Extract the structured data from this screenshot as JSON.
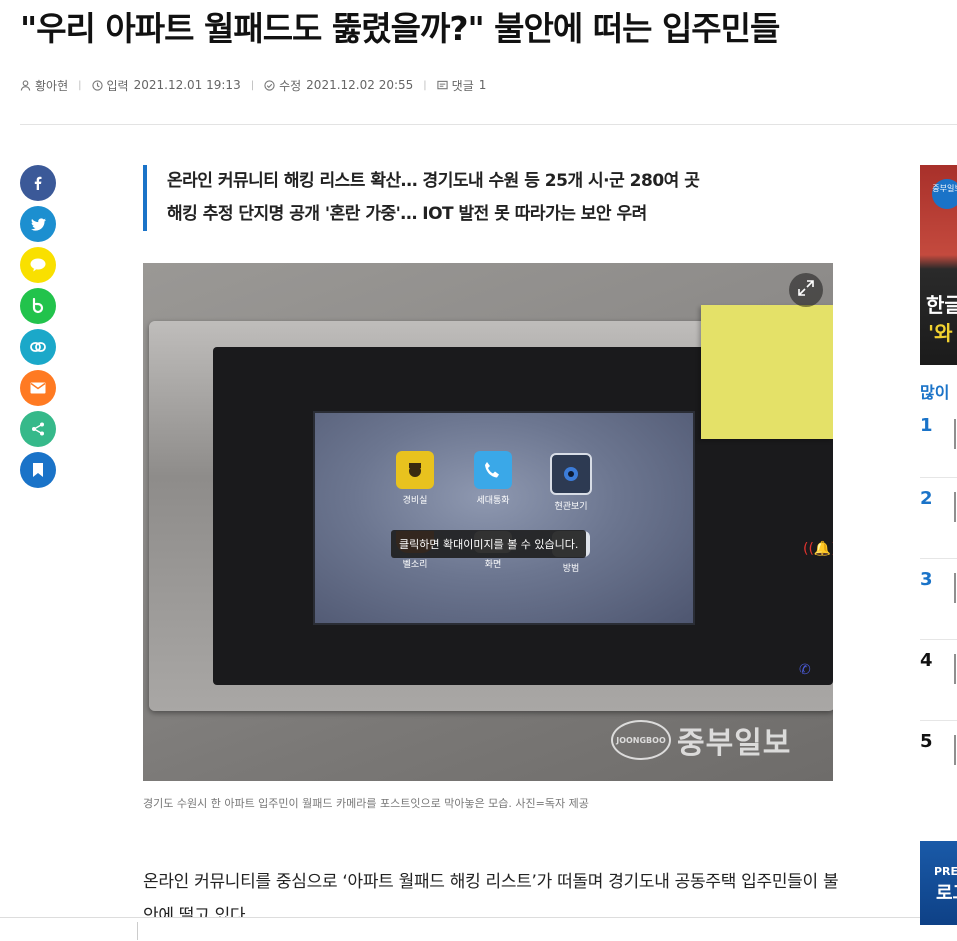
{
  "article": {
    "headline": "\"우리 아파트 월패드도 뚫렸을까?\" 불안에 떠는 입주민들",
    "author": "황아현",
    "published_label": "입력",
    "published": "2021.12.01 19:13",
    "updated_label": "수정",
    "updated": "2021.12.02 20:55",
    "comments_label": "댓글",
    "comments_count": "1",
    "subhead_line1": "온라인 커뮤니티 해킹 리스트 확산… 경기도내 수원 등 25개 시·군 280여 곳",
    "subhead_line2": "해킹 추정 단지명 공개 '혼란 가중'… IOT 발전 못 따라가는 보안 우려",
    "caption": "경기도 수원시 한 아파트 입주민이 월패드 카메라를 포스트잇으로 막아놓은 모습. 사진=독자 제공",
    "body": "온라인 커뮤니티를 중심으로 ‘아파트 월패드 해킹 리스트’가 떠돌며 경기도내 공동주택 입주민들이 불안에 떨고 있다."
  },
  "photo": {
    "tooltip": "클릭하면 확대이미지를 볼 수 있습니다.",
    "watermark": "중부일보",
    "watermark_seal": "JOONGBOO",
    "apps": [
      "경비실",
      "세대통화",
      "현관보기",
      "벨소리",
      "화면",
      "방범"
    ]
  },
  "share": [
    "facebook-icon",
    "twitter-icon",
    "kakaotalk-icon",
    "band-icon",
    "link-icon",
    "email-icon",
    "share-icon",
    "bookmark-icon"
  ],
  "colors": {
    "facebook": "#3b5998",
    "twitter": "#1c8fd0",
    "kakao": "#f9e000",
    "band": "#22c34c",
    "link": "#1ba8c9",
    "email": "#ff7a22",
    "share": "#36b98a",
    "bookmark": "#1a73c8",
    "accent": "#1a73c8"
  },
  "rail": {
    "promo_badge": "중부일보",
    "promo_line1": "한글",
    "promo_line2": "'와",
    "rank_title": "많이",
    "ranks": [
      "1",
      "2",
      "3",
      "4",
      "5"
    ],
    "ad_line1": "PRE",
    "ad_line2": "로고"
  }
}
